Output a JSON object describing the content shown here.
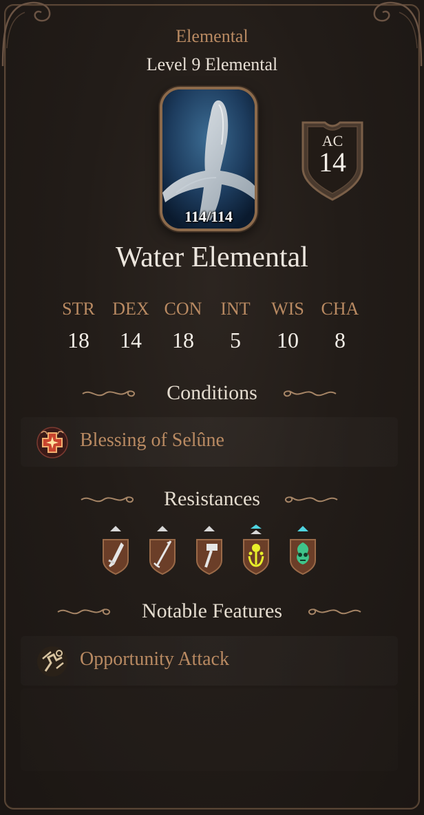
{
  "header": {
    "creature_type": "Elemental",
    "level_line": "Level 9 Elemental"
  },
  "portrait": {
    "hp": "114/114",
    "hp_fraction": 1.0
  },
  "armor_class": {
    "label": "AC",
    "value": "14"
  },
  "name": "Water Elemental",
  "abilities": [
    {
      "key": "STR",
      "value": "18"
    },
    {
      "key": "DEX",
      "value": "14"
    },
    {
      "key": "CON",
      "value": "18"
    },
    {
      "key": "INT",
      "value": "5"
    },
    {
      "key": "WIS",
      "value": "10"
    },
    {
      "key": "CHA",
      "value": "8"
    }
  ],
  "sections": {
    "conditions": {
      "title": "Conditions",
      "items": [
        {
          "label": "Blessing of Selûne",
          "icon": "blessing-icon"
        }
      ]
    },
    "resistances": {
      "title": "Resistances",
      "items": [
        {
          "icon": "slashing-icon",
          "tier": "resistant"
        },
        {
          "icon": "piercing-icon",
          "tier": "resistant"
        },
        {
          "icon": "bludgeoning-icon",
          "tier": "resistant"
        },
        {
          "icon": "acid-icon",
          "tier": "immune"
        },
        {
          "icon": "poison-icon",
          "tier": "immune"
        }
      ]
    },
    "features": {
      "title": "Notable Features",
      "items": [
        {
          "label": "Opportunity Attack",
          "icon": "opportunity-attack-icon"
        }
      ]
    }
  },
  "colors": {
    "accent_label": "#b98a62",
    "text_main": "#e8e0d6",
    "background": "#221c18",
    "frame": "#5a4636",
    "immune_marker": "#4fd4e0",
    "resist_marker": "#d8d8d8"
  }
}
